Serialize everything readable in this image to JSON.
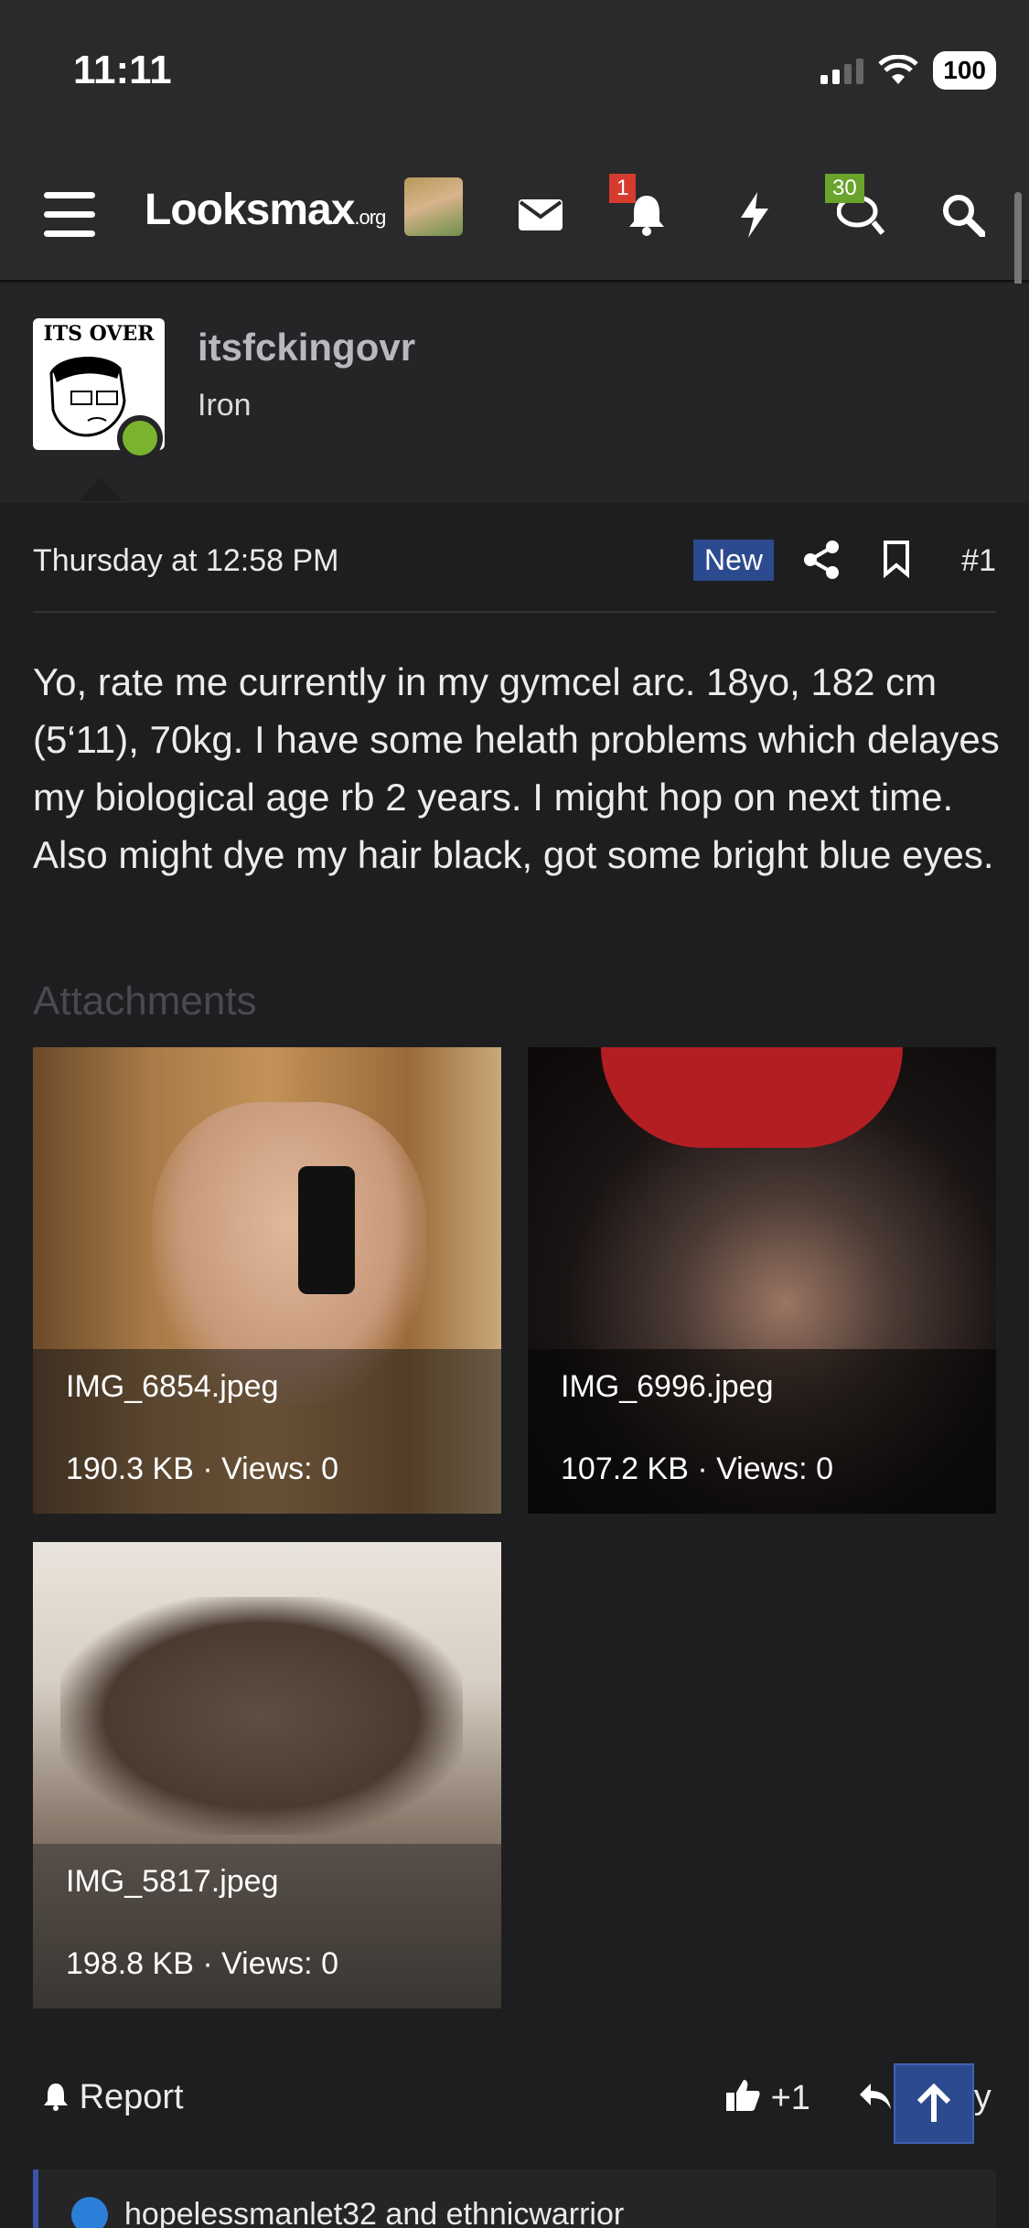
{
  "status_bar": {
    "time": "11:11",
    "battery": "100"
  },
  "navbar": {
    "logo_main": "Looksmax",
    "logo_suffix": ".org",
    "notifications_count": "1",
    "conversations_count": "30"
  },
  "post": {
    "author": {
      "name": "itsfckingovr",
      "title": "Iron",
      "avatar_caption": "ITS OVER"
    },
    "date": "Thursday at 12:58 PM",
    "new_label": "New",
    "number": "#1",
    "body": "Yo, rate me currently in my gymcel arc. 18yo, 182 cm (5‘11), 70kg. I have some helath problems which delayes my biological age rb 2 years. I might hop on next time. Also might dye my hair black, got some bright blue eyes.",
    "attachments_heading": "Attachments",
    "attachments": [
      {
        "filename": "IMG_6854.jpeg",
        "meta": "190.3 KB · Views: 0"
      },
      {
        "filename": "IMG_6996.jpeg",
        "meta": "107.2 KB · Views: 0"
      },
      {
        "filename": "IMG_5817.jpeg",
        "meta": "198.8 KB · Views: 0"
      }
    ],
    "actions": {
      "report": "Report",
      "like": "+1",
      "reply": "Reply"
    },
    "likes_text": "hopelessmanlet32 and ethnicwarrior"
  },
  "colors": {
    "accent": "#2c4a8f",
    "online": "#7ab32e",
    "alert": "#d63b2f",
    "conversation": "#6aa42c"
  }
}
